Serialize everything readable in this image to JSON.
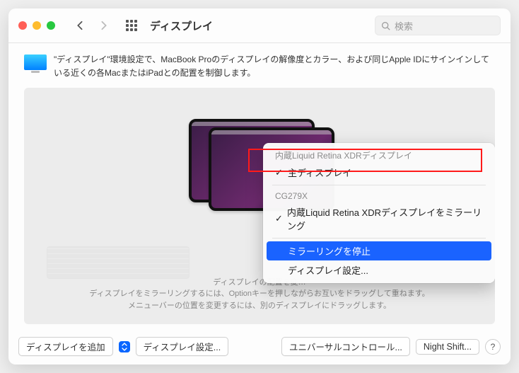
{
  "titlebar": {
    "title": "ディスプレイ",
    "search_placeholder": "検索"
  },
  "description": "\"ディスプレイ\"環境設定で、MacBook Proのディスプレイの解像度とカラー、および同じApple IDにサインインしている近くの各MacまたはiPadとの配置を制御します。",
  "menu": {
    "hdr1": "内蔵Liquid Retina XDRディスプレイ",
    "item_main": "主ディスプレイ",
    "hdr2": "CG279X",
    "item_mirror": "内蔵Liquid Retina XDRディスプレイをミラーリング",
    "item_stop": "ミラーリングを停止",
    "item_settings": "ディスプレイ設定..."
  },
  "hints": {
    "l1": "ディスプレイの配置を変…",
    "l2": "ディスプレイをミラーリングするには、Optionキーを押しながらお互いをドラッグして重ねます。",
    "l3": "メニューバーの位置を変更するには、別のディスプレイにドラッグします。"
  },
  "footer": {
    "add": "ディスプレイを追加",
    "settings": "ディスプレイ設定...",
    "universal": "ユニバーサルコントロール...",
    "night": "Night Shift...",
    "help": "?"
  }
}
